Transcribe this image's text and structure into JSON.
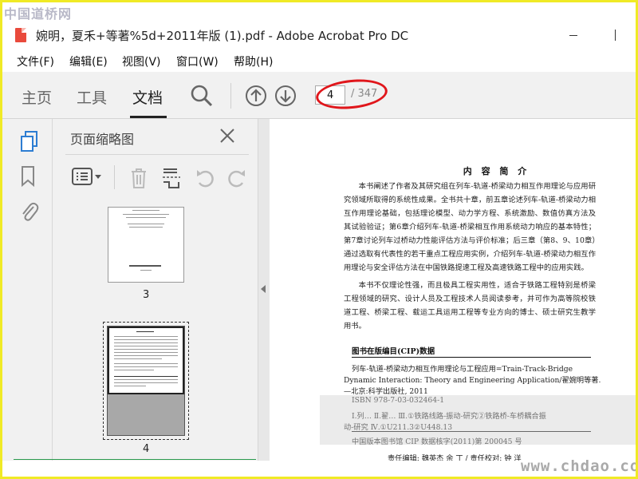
{
  "watermark_top": "中国道桥网",
  "watermark_bottom": "www.chdao.com",
  "window": {
    "title": "婉明，夏禾+等著%5d+2011年版 (1).pdf - Adobe Acrobat Pro DC"
  },
  "menu": [
    "文件(F)",
    "编辑(E)",
    "视图(V)",
    "窗口(W)",
    "帮助(H)"
  ],
  "toolbar": {
    "tabs": [
      "主页",
      "工具",
      "文档"
    ],
    "active_tab": "文档",
    "current_page": "4",
    "total_pages": "/ 347"
  },
  "thumbnail_panel": {
    "title": "页面缩略图",
    "thumbs": [
      {
        "label": "3"
      },
      {
        "label": "4",
        "selected": true
      }
    ]
  },
  "document": {
    "heading": "内 容 简 介",
    "para1": "本书阐述了作者及其研究组在列车-轨道-桥梁动力相互作用理论与应用研究领域所取得的系统性成果。全书共十章，前五章论述列车-轨道-桥梁动力相互作用理论基础，包括理论模型、动力学方程、系统激励、数值仿真方法及其试验验证；第6章介绍列车-轨道-桥梁相互作用系统动力响应的基本特性；第7章讨论列车过桥动力性能评估方法与评价标准；后三章（第8、9、10章）通过选取有代表性的若干重点工程应用实例，介绍列车-轨道-桥梁动力相互作用理论与安全评估方法在中国铁路提速工程及高速铁路工程中的应用实践。",
    "para2": "本书不仅理论性强，而且极具工程实用性，适合于铁路工程特别是桥梁工程领域的研究、设计人员及工程技术人员阅读参考，并可作为高等院校铁道工程、桥梁工程、载运工具运用工程等专业方向的博士、硕士研究生教学用书。",
    "cip_title": "图书在版编目(CIP)数据",
    "cip_lines": [
      "列车-轨道-桥梁动力相互作用理论与工程应用=Train-Track-Bridge",
      "Dynamic Interaction: Theory and Engineering Application/翟婉明等著.",
      "—北京:科学出版社, 2011",
      "ISBN 978-7-03-032464-1",
      "Ⅰ.列…  Ⅱ.翟…  Ⅲ.①铁路线路-振动-研究②铁路桥-车桥耦合振",
      "动-研究  Ⅳ.①U211.3②U448.13",
      "中国版本图书馆 CIP 数据核字(2011)第 200045 号",
      "责任编辑: 魏英杰  余  丁 / 责任校对: 钟  洋"
    ]
  },
  "colors": {
    "highlight_ellipse": "#e0161b",
    "frame_border": "#f0ea26"
  }
}
